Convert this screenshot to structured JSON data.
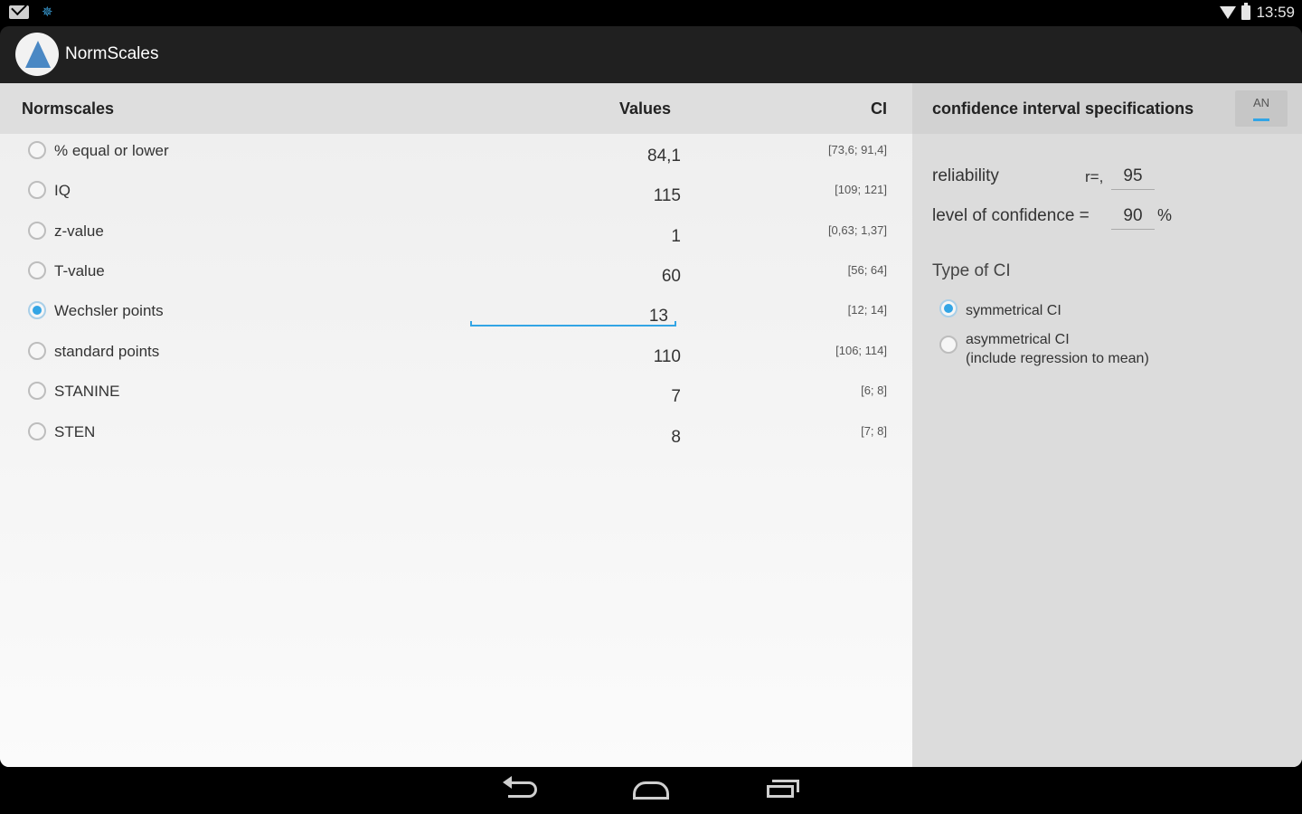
{
  "status_bar": {
    "time": "13:59"
  },
  "action_bar": {
    "title": "NormScales"
  },
  "table": {
    "headers": {
      "name": "Normscales",
      "values": "Values",
      "ci": "CI"
    },
    "rows": [
      {
        "label": "% equal or lower",
        "value": "84,1",
        "ci": "[73,6; 91,4]",
        "selected": false
      },
      {
        "label": "IQ",
        "value": "115",
        "ci": "[109; 121]",
        "selected": false
      },
      {
        "label": "z-value",
        "value": "1",
        "ci": "[0,63; 1,37]",
        "selected": false
      },
      {
        "label": "T-value",
        "value": "60",
        "ci": "[56; 64]",
        "selected": false
      },
      {
        "label": "Wechsler points",
        "value": "13",
        "ci": "[12; 14]",
        "selected": true
      },
      {
        "label": "standard points",
        "value": "110",
        "ci": "[106; 114]",
        "selected": false
      },
      {
        "label": "STANINE",
        "value": "7",
        "ci": "[6; 8]",
        "selected": false
      },
      {
        "label": "STEN",
        "value": "8",
        "ci": "[7; 8]",
        "selected": false
      }
    ]
  },
  "ci_panel": {
    "title": "confidence interval specifications",
    "an_button": "AN",
    "reliability_label": "reliability",
    "r_label": "r=,",
    "reliability_value": "95",
    "confidence_label": "level of confidence =",
    "confidence_value": "90",
    "percent": "%",
    "type_label": "Type of CI",
    "options": [
      {
        "line1": "symmetrical CI",
        "line2": "",
        "selected": true
      },
      {
        "line1": "asymmetrical CI",
        "line2": "(include regression to mean)",
        "selected": false
      }
    ]
  },
  "colors": {
    "accent": "#33a5e5",
    "action_bar": "#202020",
    "right_pane": "#dcdcdc"
  }
}
